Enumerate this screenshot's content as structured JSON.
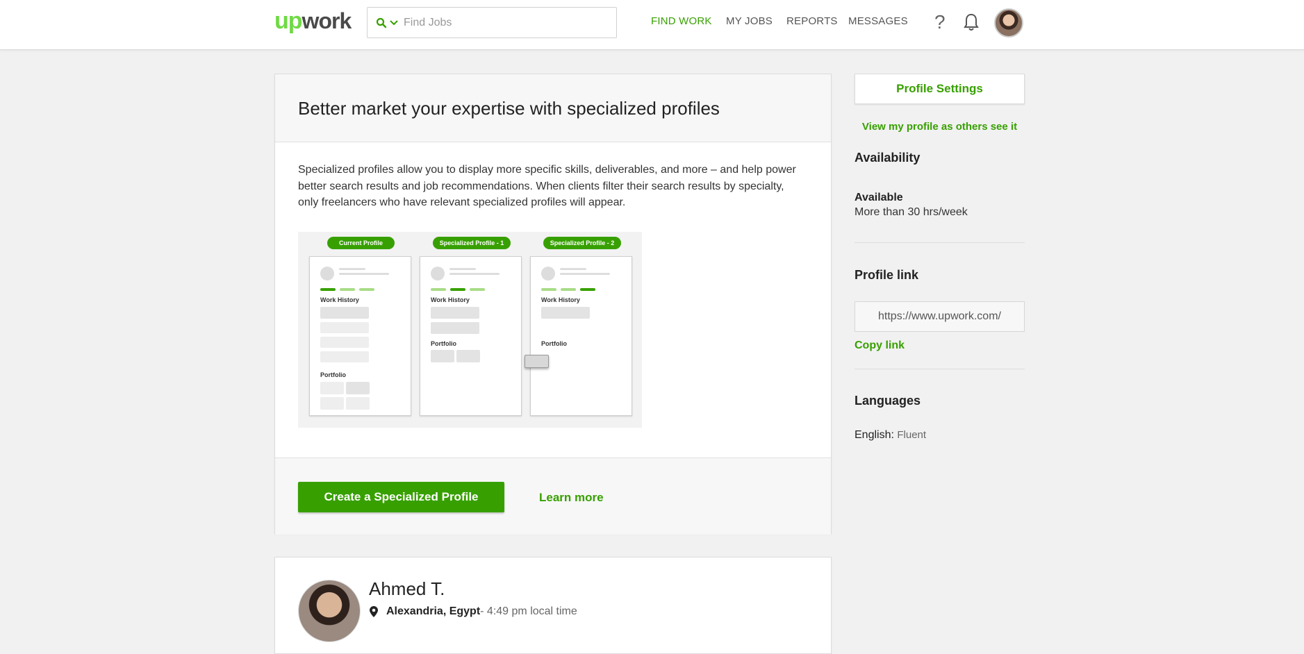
{
  "header": {
    "logo_up": "up",
    "logo_work": "work",
    "search_placeholder": "Find Jobs",
    "nav": {
      "find_work": "FIND WORK",
      "my_jobs": "MY JOBS",
      "reports": "REPORTS",
      "messages": "MESSAGES"
    },
    "help_glyph": "?"
  },
  "promo": {
    "title": "Better market your expertise with specialized profiles",
    "description": "Specialized profiles allow you to display more specific skills, deliverables, and more – and help power better search results and job recommendations. When clients filter their search results by specialty, only freelancers who have relevant specialized profiles will appear.",
    "illustration": {
      "tag_current": "Current Profile",
      "tag_spec1": "Specialized Profile - 1",
      "tag_spec2": "Specialized Profile - 2",
      "work_history": "Work History",
      "portfolio": "Portfolio"
    },
    "create_button": "Create a Specialized Profile",
    "learn_more": "Learn more"
  },
  "profile": {
    "name": "Ahmed T.",
    "location": "Alexandria, Egypt",
    "local_time": " - 4:49 pm local time"
  },
  "sidebar": {
    "settings_button": "Profile Settings",
    "view_as_others": "View my profile as others see it",
    "availability_heading": "Availability",
    "availability_status": "Available",
    "availability_hours": "More than 30 hrs/week",
    "profile_link_heading": "Profile link",
    "profile_link_value": "https://www.upwork.com/",
    "copy_link": "Copy link",
    "languages_heading": "Languages",
    "language_name": "English:",
    "language_level": "Fluent"
  },
  "colors": {
    "brand_green": "#37a000",
    "logo_green": "#6fda44"
  }
}
